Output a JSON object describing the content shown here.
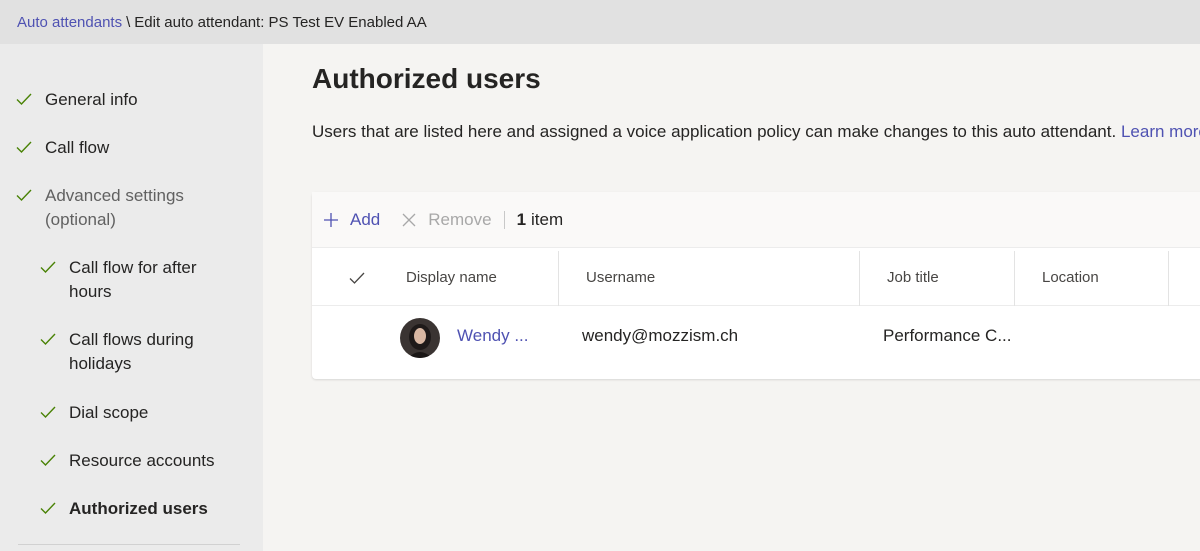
{
  "breadcrumb": {
    "parent": "Auto attendants",
    "separator": "\\",
    "current": "Edit auto attendant: PS Test EV Enabled AA"
  },
  "sidebar": {
    "items": [
      {
        "label": "General info"
      },
      {
        "label": "Call flow"
      },
      {
        "label": "Advanced settings (optional)"
      },
      {
        "label": "Call flow for after hours"
      },
      {
        "label": "Call flows during holidays"
      },
      {
        "label": "Dial scope"
      },
      {
        "label": "Resource accounts"
      },
      {
        "label": "Authorized users"
      }
    ]
  },
  "main": {
    "title": "Authorized users",
    "description": "Users that are listed here and assigned a voice application policy can make changes to this auto attendant.",
    "learn_more": "Learn more"
  },
  "toolbar": {
    "add_label": "Add",
    "remove_label": "Remove",
    "count_number": "1",
    "count_label": "item"
  },
  "table": {
    "columns": [
      "Display name",
      "Username",
      "Job title",
      "Location"
    ],
    "rows": [
      {
        "display_name": "Wendy ...",
        "username": "wendy@mozzism.ch",
        "job_title": "Performance C...",
        "location": ""
      }
    ]
  },
  "colors": {
    "accent": "#4f52b2",
    "check": "#498205"
  }
}
